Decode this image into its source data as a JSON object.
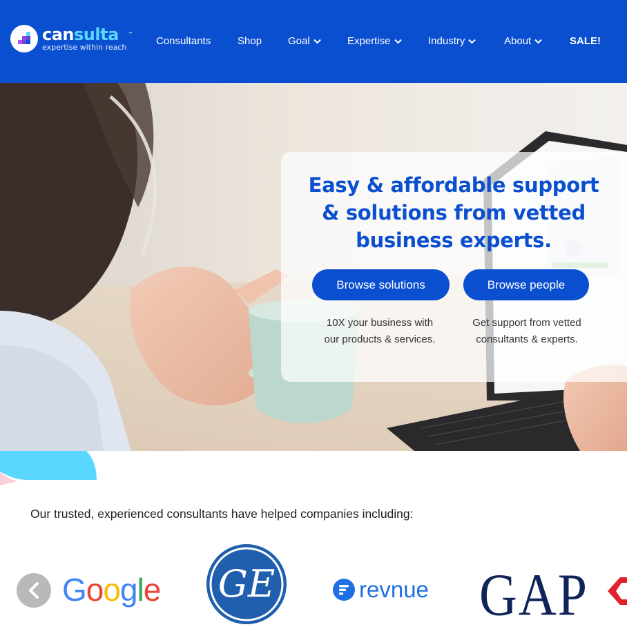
{
  "header": {
    "logo": {
      "word_prefix": "can",
      "word_suffix": "sulta",
      "tm": "™",
      "tagline": "expertise within reach"
    },
    "nav": [
      {
        "label": "Consultants",
        "dropdown": false
      },
      {
        "label": "Shop",
        "dropdown": false
      },
      {
        "label": "Goal",
        "dropdown": true
      },
      {
        "label": "Expertise",
        "dropdown": true
      },
      {
        "label": "Industry",
        "dropdown": true
      },
      {
        "label": "About",
        "dropdown": true
      },
      {
        "label": "SALE!",
        "dropdown": false
      }
    ]
  },
  "hero": {
    "title_line1": "Easy & affordable support",
    "title_line2": "& solutions from vetted",
    "title_line3": "business experts.",
    "buttons": [
      {
        "label": "Browse solutions",
        "desc_line1": "10X your business with",
        "desc_line2": "our products & services."
      },
      {
        "label": "Browse people",
        "desc_line1": "Get support from vetted",
        "desc_line2": "consultants & experts."
      }
    ]
  },
  "trusted": {
    "heading": "Our trusted, experienced consultants have helped companies including:",
    "logos": [
      "Google",
      "GE",
      "revnue",
      "GAP"
    ]
  },
  "colors": {
    "brand_blue": "#0a4fd0",
    "accent_cyan": "#5ad7ff",
    "card_bg": "rgba(255,255,255,0.72)"
  }
}
